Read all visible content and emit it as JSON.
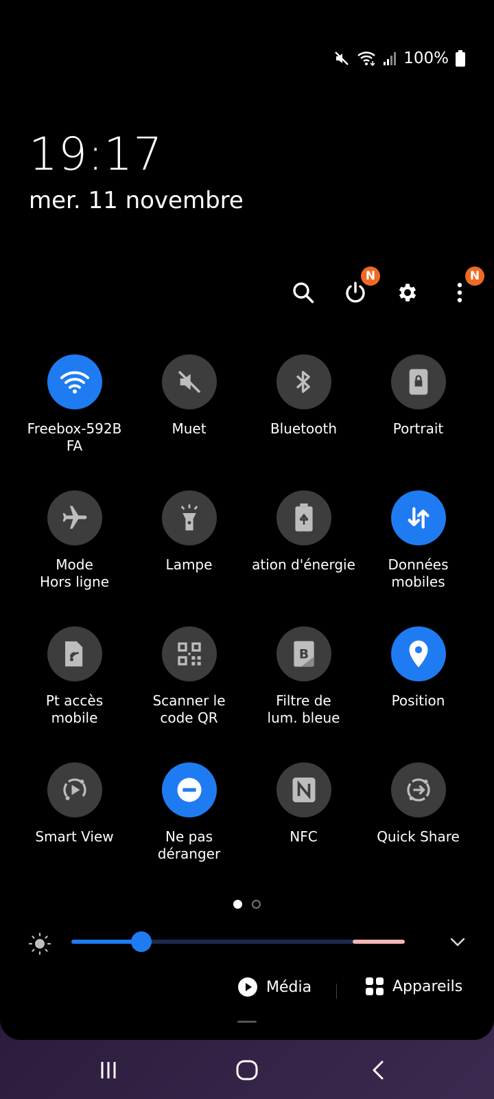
{
  "status_bar": {
    "battery_percent": "100%",
    "icons": [
      "mute-icon",
      "wifi-icon",
      "signal-icon",
      "battery-icon"
    ]
  },
  "clock": {
    "time": "19:17",
    "date": "mer. 11 novembre"
  },
  "top_actions": {
    "icons": [
      "search-icon",
      "power-icon",
      "gear-icon",
      "more-vertical-icon"
    ],
    "power_badge": "N",
    "more_badge": "N"
  },
  "tiles": [
    {
      "label": "Freebox-592B\nFA",
      "icon": "wifi-icon",
      "active": true
    },
    {
      "label": "Muet",
      "icon": "mute-icon",
      "active": false
    },
    {
      "label": "Bluetooth",
      "icon": "bluetooth-icon",
      "active": false
    },
    {
      "label": "Portrait",
      "icon": "screen-lock-icon",
      "active": false
    },
    {
      "label": "Mode\nHors ligne",
      "icon": "airplane-icon",
      "active": false
    },
    {
      "label": "Lampe",
      "icon": "flashlight-icon",
      "active": false
    },
    {
      "label": "ation d'énergie",
      "icon": "battery-saver-icon",
      "active": false
    },
    {
      "label": "Données\nmobiles",
      "icon": "mobile-data-icon",
      "active": true
    },
    {
      "label": "Pt accès\nmobile",
      "icon": "hotspot-icon",
      "active": false
    },
    {
      "label": "Scanner le\ncode QR",
      "icon": "qr-code-icon",
      "active": false
    },
    {
      "label": "Filtre de\nlum. bleue",
      "icon": "blue-light-icon",
      "active": false
    },
    {
      "label": "Position",
      "icon": "location-icon",
      "active": true
    },
    {
      "label": "Smart View",
      "icon": "smart-view-icon",
      "active": false
    },
    {
      "label": "Ne pas\ndéranger",
      "icon": "do-not-disturb-icon",
      "active": true
    },
    {
      "label": "NFC",
      "icon": "nfc-icon",
      "active": false
    },
    {
      "label": "Quick Share",
      "icon": "quick-share-icon",
      "active": false
    }
  ],
  "page_indicator": {
    "current": 1,
    "total": 2
  },
  "brightness": {
    "level": 0.21
  },
  "bottom": {
    "media_label": "Média",
    "devices_label": "Appareils"
  },
  "nav_bar": {
    "icons": [
      "recent-apps-icon",
      "home-icon",
      "back-icon"
    ]
  },
  "colors": {
    "accent": "#1f7bf2",
    "tile_inactive": "#3d3d3d",
    "badge": "#f06a22"
  }
}
